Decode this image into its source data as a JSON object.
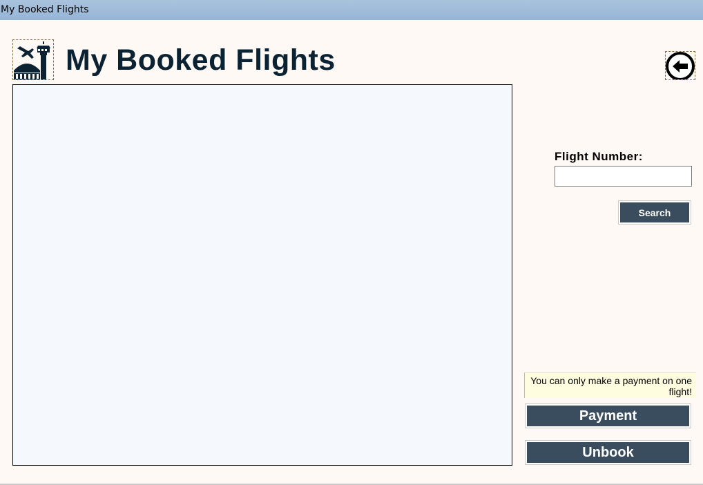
{
  "window": {
    "title": "My Booked Flights"
  },
  "header": {
    "title": "My Booked Flights"
  },
  "search": {
    "flight_number_label": "Flight Number:",
    "flight_number_value": "",
    "search_label": "Search"
  },
  "actions": {
    "payment_note": "You can only make a payment on one flight!",
    "payment_label": "Payment",
    "unbook_label": "Unbook"
  },
  "colors": {
    "background": "#fef9f4",
    "title_text": "#0b2233",
    "button_bg": "#3a4d5e",
    "list_bg": "#f5f8fc",
    "note_bg": "#fffde0"
  },
  "icons": {
    "logo": "airport-terminal-icon",
    "back": "back-arrow-icon"
  }
}
